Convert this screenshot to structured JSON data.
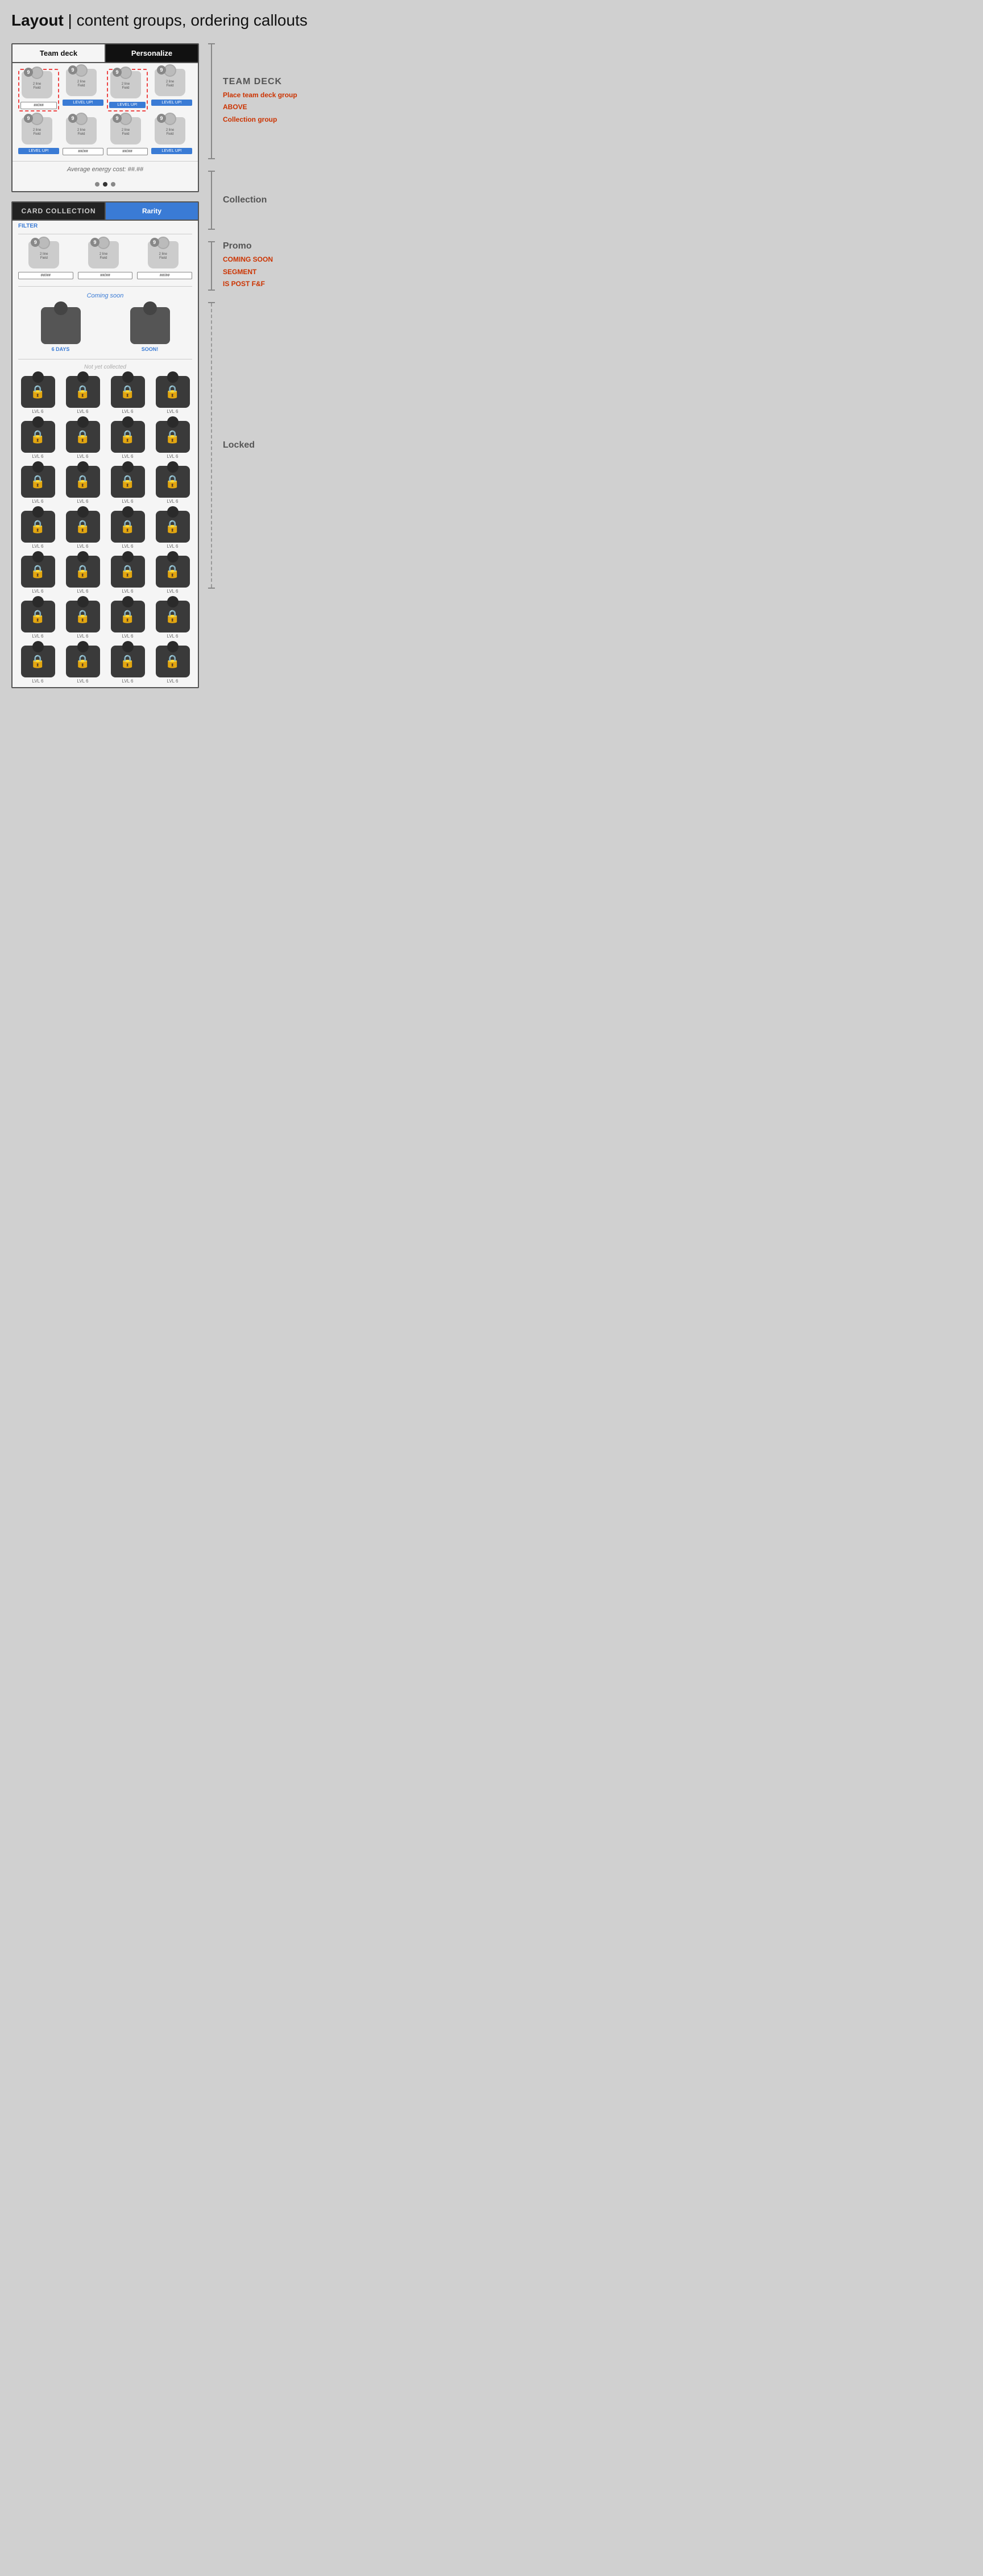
{
  "page": {
    "title_bold": "Layout",
    "title_normal": " | content groups, ordering callouts"
  },
  "team_deck": {
    "tab1": "Team deck",
    "tab2": "Personalize",
    "label": "TEAM DECK",
    "annotation_line1": "Place team deck group",
    "annotation_line2": "ABOVE",
    "annotation_line3": "Collection group",
    "avg_energy": "Average energy cost: ##.##",
    "dots": [
      false,
      true,
      false
    ],
    "card_num": "9",
    "field_label": "2 line\nField",
    "btn_label": "##/##",
    "btn_levelup": "LEVEL UP!",
    "cards": [
      {
        "dashed": true,
        "has_btn": true,
        "btn_type": "text",
        "btn_text": "##/##"
      },
      {
        "dashed": false,
        "has_btn": true,
        "btn_type": "levelup",
        "btn_text": "LEVEL UP!"
      },
      {
        "dashed": true,
        "has_btn": true,
        "btn_type": "levelup",
        "btn_text": "LEVEL UP!"
      },
      {
        "dashed": false,
        "has_btn": true,
        "btn_type": "levelup",
        "btn_text": "LEVEL UP!"
      },
      {
        "dashed": false,
        "has_btn": true,
        "btn_type": "levelup",
        "btn_text": "LEVEL UP!"
      },
      {
        "dashed": false,
        "has_btn": true,
        "btn_type": "text",
        "btn_text": "##/##"
      },
      {
        "dashed": false,
        "has_btn": true,
        "btn_type": "text",
        "btn_text": "##/##"
      },
      {
        "dashed": false,
        "has_btn": true,
        "btn_type": "levelup",
        "btn_text": "LEVEL UP!"
      }
    ]
  },
  "collection": {
    "tab1": "CARD COLLECTION",
    "tab2": "Rarity",
    "filter": "FILTER",
    "label": "Collection",
    "cards": [
      {
        "btn_text": "##/##"
      },
      {
        "btn_text": "##/##"
      },
      {
        "btn_text": "##/##"
      }
    ]
  },
  "promo": {
    "label": "Promo",
    "coming_soon": "Coming soon",
    "annotation_line1": "COMING SOON",
    "annotation_line2": "SEGMENT",
    "annotation_line3": "IS POST F&F",
    "cards": [
      {
        "days": "6 DAYS"
      },
      {
        "days": "SOON!"
      }
    ]
  },
  "locked": {
    "header": "Not yet collected",
    "label": "Locked",
    "rows": 7,
    "cols": 4,
    "lvl_text": "LVL 6"
  },
  "icons": {
    "lock": "🔒",
    "dot": "●"
  }
}
